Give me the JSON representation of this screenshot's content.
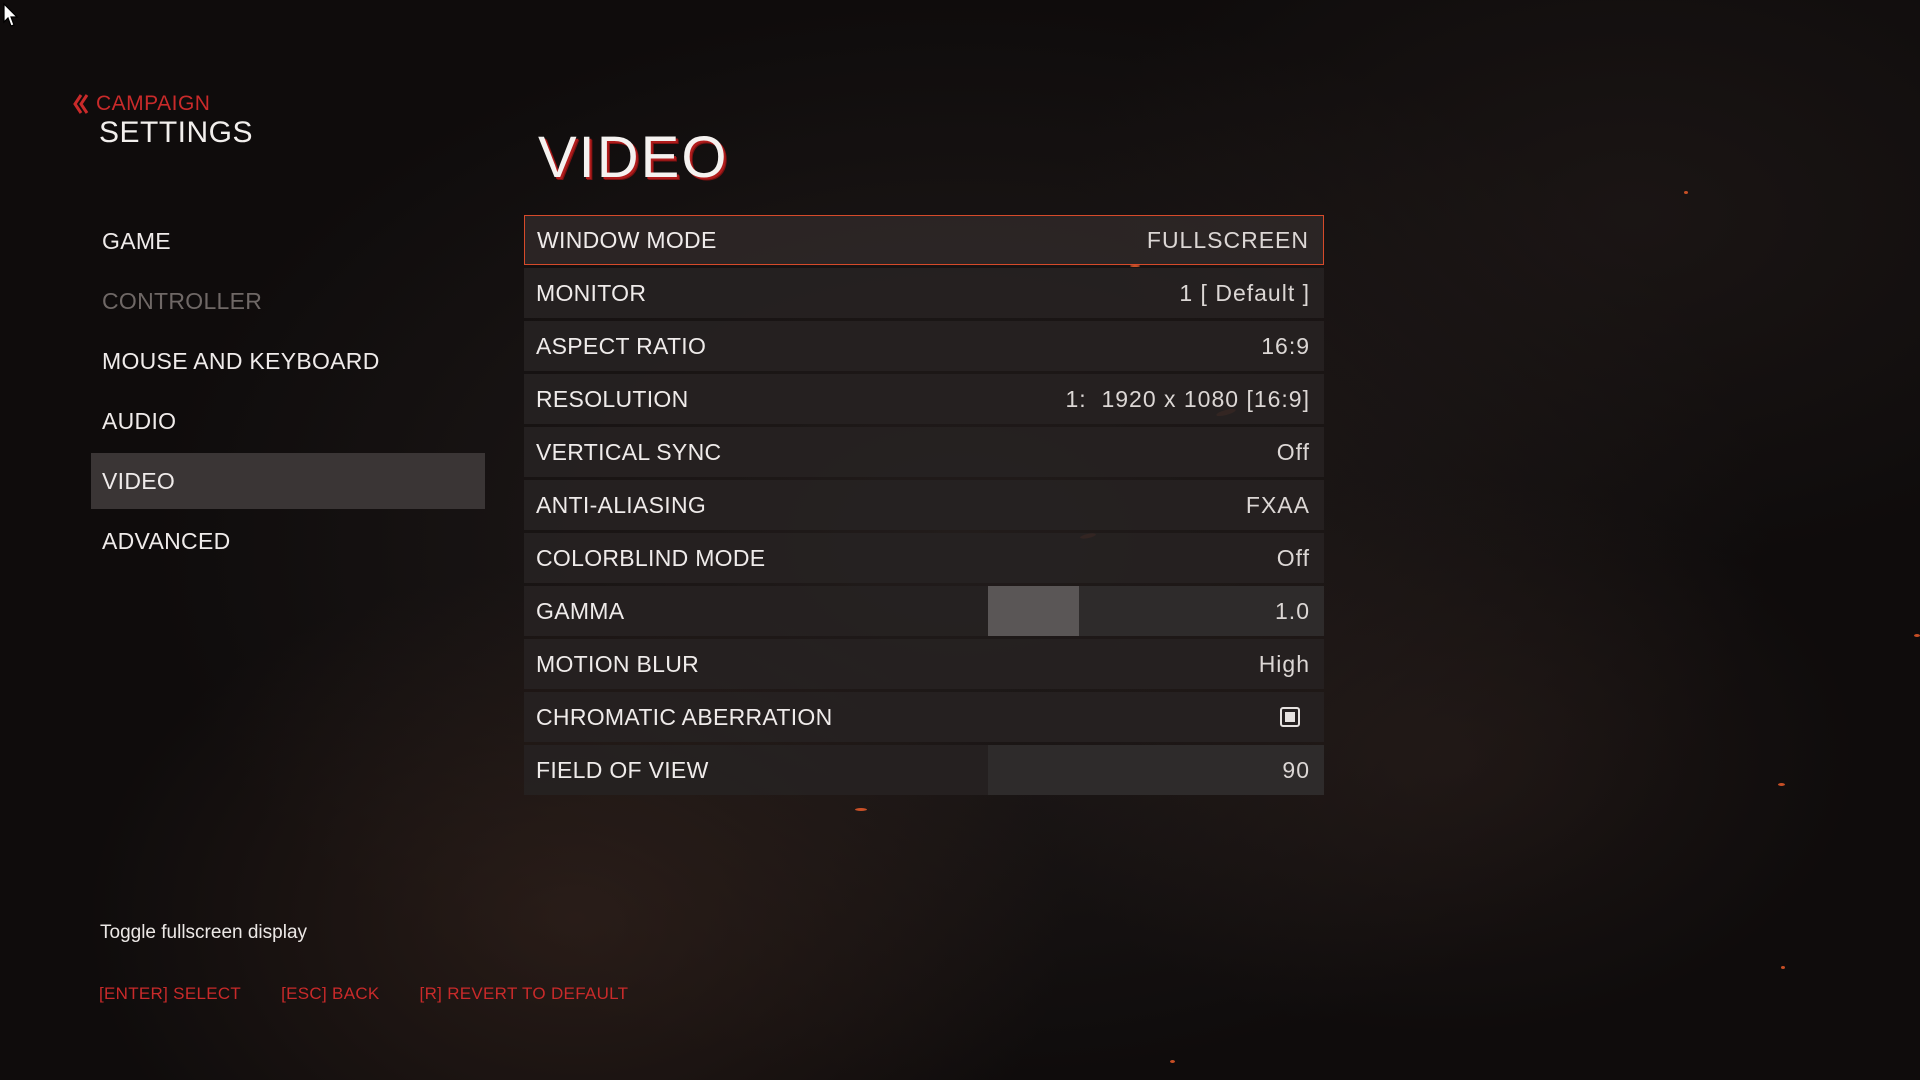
{
  "breadcrumb": {
    "parent": "CAMPAIGN"
  },
  "header": {
    "section": "SETTINGS",
    "page_title": "VIDEO"
  },
  "sidebar": {
    "items": [
      {
        "label": "GAME",
        "state": "normal"
      },
      {
        "label": "CONTROLLER",
        "state": "disabled"
      },
      {
        "label": "MOUSE AND KEYBOARD",
        "state": "normal"
      },
      {
        "label": "AUDIO",
        "state": "normal"
      },
      {
        "label": "VIDEO",
        "state": "active"
      },
      {
        "label": "ADVANCED",
        "state": "normal"
      }
    ]
  },
  "options": [
    {
      "label": "WINDOW MODE",
      "value": "FULLSCREEN",
      "selected": true
    },
    {
      "label": "MONITOR",
      "value": "1 [ Default ]"
    },
    {
      "label": "ASPECT RATIO",
      "value": "16:9"
    },
    {
      "label": "RESOLUTION",
      "value": "1:  1920 x 1080 [16:9]"
    },
    {
      "label": "VERTICAL SYNC",
      "value": "Off"
    },
    {
      "label": "ANTI-ALIASING",
      "value": "FXAA"
    },
    {
      "label": "COLORBLIND MODE",
      "value": "Off"
    },
    {
      "label": "GAMMA",
      "value": "1.0",
      "slider_fraction": 0.27
    },
    {
      "label": "MOTION BLUR",
      "value": "High"
    },
    {
      "label": "CHROMATIC ABERRATION",
      "checked": true
    },
    {
      "label": "FIELD OF VIEW",
      "value": "90",
      "slider_fraction": 0.0
    }
  ],
  "hint": "Toggle fullscreen display",
  "controls": {
    "select": "[ENTER] SELECT",
    "back": "[ESC] BACK",
    "revert": "[R] REVERT TO DEFAULT"
  },
  "colors": {
    "accent": "#c92a2a",
    "title_shadow": "#b01c1c",
    "selected_border": "#d64a2a"
  },
  "icons": {
    "breadcrumb": "double-chevron-left-icon",
    "cursor": "mouse-cursor-icon"
  }
}
